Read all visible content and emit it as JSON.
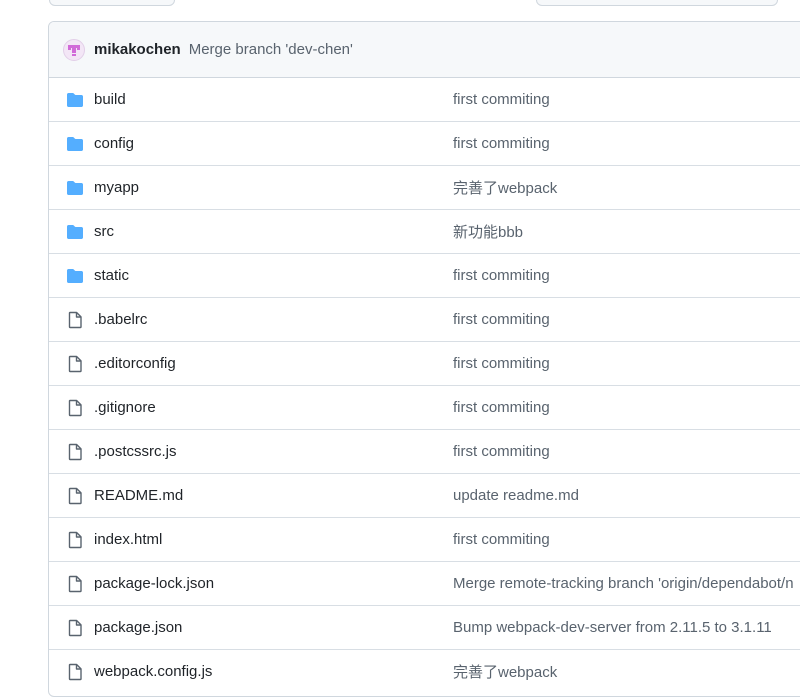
{
  "commit": {
    "author": "mikakochen",
    "message": "Merge branch 'dev-chen'"
  },
  "colors": {
    "folder": "#54aeff",
    "file_icon": "#59636e",
    "avatar": "#d16ad8"
  },
  "files": [
    {
      "name": "build",
      "type": "folder",
      "icon": "folder-icon",
      "message": "first commiting"
    },
    {
      "name": "config",
      "type": "folder",
      "icon": "folder-icon",
      "message": "first commiting"
    },
    {
      "name": "myapp",
      "type": "folder",
      "icon": "folder-icon",
      "message": "完善了webpack"
    },
    {
      "name": "src",
      "type": "folder",
      "icon": "folder-icon",
      "message": "新功能bbb"
    },
    {
      "name": "static",
      "type": "folder",
      "icon": "folder-icon",
      "message": "first commiting"
    },
    {
      "name": ".babelrc",
      "type": "file",
      "icon": "file-icon",
      "message": "first commiting"
    },
    {
      "name": ".editorconfig",
      "type": "file",
      "icon": "file-icon",
      "message": "first commiting"
    },
    {
      "name": ".gitignore",
      "type": "file",
      "icon": "file-icon",
      "message": "first commiting"
    },
    {
      "name": ".postcssrc.js",
      "type": "file",
      "icon": "file-icon",
      "message": "first commiting"
    },
    {
      "name": "README.md",
      "type": "file",
      "icon": "file-icon",
      "message": "update readme.md"
    },
    {
      "name": "index.html",
      "type": "file",
      "icon": "file-icon",
      "message": "first commiting"
    },
    {
      "name": "package-lock.json",
      "type": "file",
      "icon": "file-icon",
      "message": "Merge remote-tracking branch 'origin/dependabot/n"
    },
    {
      "name": "package.json",
      "type": "file",
      "icon": "file-icon",
      "message": "Bump webpack-dev-server from 2.11.5 to 3.1.11"
    },
    {
      "name": "webpack.config.js",
      "type": "file",
      "icon": "file-icon",
      "message": "完善了webpack"
    }
  ]
}
